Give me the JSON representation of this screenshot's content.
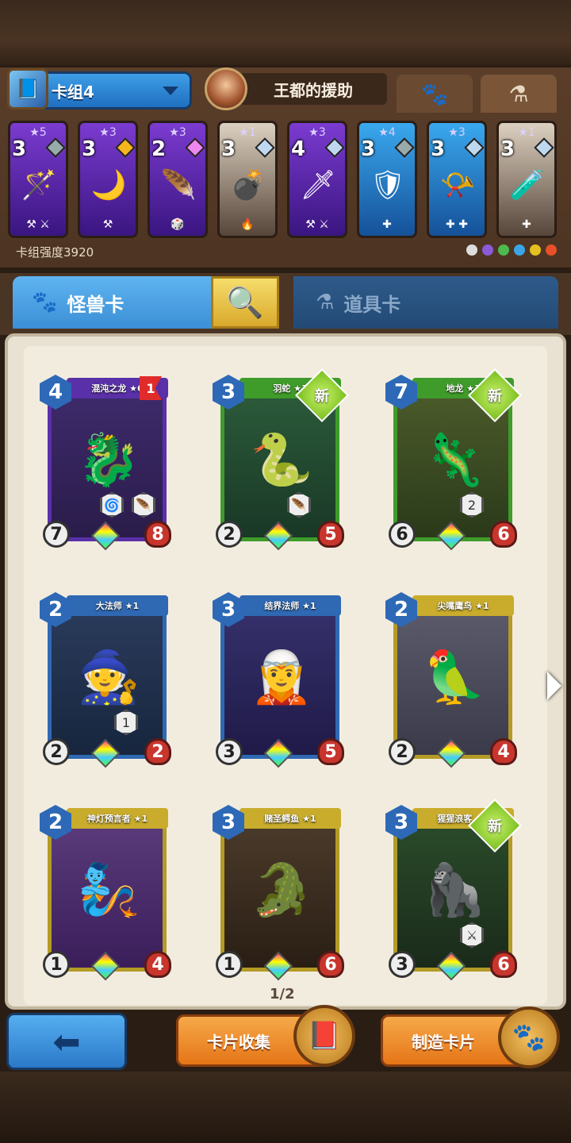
{
  "header": {
    "deck_label": "卡组4",
    "hero_name": "王都的援助",
    "deck_strength": "卡组强度3920"
  },
  "deck": [
    {
      "stars": "★5",
      "cost": "3",
      "color": "purple",
      "gem": "#9aa",
      "art": "🪄",
      "tags": "⚒ ⚔"
    },
    {
      "stars": "★3",
      "cost": "3",
      "color": "purple",
      "gem": "#f5b51f",
      "art": "🌙",
      "tags": "⚒"
    },
    {
      "stars": "★3",
      "cost": "2",
      "color": "purple",
      "gem": "#e8e",
      "art": "🪶",
      "tags": "🎲"
    },
    {
      "stars": "★1",
      "cost": "3",
      "color": "red",
      "gem": "#bfd8f0",
      "art": "💣",
      "tags": "🔥"
    },
    {
      "stars": "★3",
      "cost": "4",
      "color": "purple",
      "gem": "#bfd8f0",
      "art": "🗡",
      "tags": "⚒ ⚔"
    },
    {
      "stars": "★4",
      "cost": "3",
      "color": "blue",
      "gem": "#9aa",
      "art": "🛡",
      "tags": "✚"
    },
    {
      "stars": "★3",
      "cost": "3",
      "color": "blue",
      "gem": "#bfd8f0",
      "art": "📯",
      "tags": "✚ ✚"
    },
    {
      "stars": "★1",
      "cost": "3",
      "color": "red",
      "gem": "#bfd8f0",
      "art": "🧪",
      "tags": "✚"
    }
  ],
  "elements": [
    "#ddd",
    "#8a5ad8",
    "#4cba4c",
    "#3ba5e8",
    "#e5c020",
    "#e8502a"
  ],
  "categories": {
    "monster": "怪兽卡",
    "item": "道具卡"
  },
  "cards": [
    {
      "name": "混沌之龙 ★6",
      "cost": "4",
      "atk": "7",
      "hp": "8",
      "frame": "purplef",
      "bg": "linear-gradient(#3d2a6b,#2a1c4a)",
      "figure": "🐉",
      "flag": "1",
      "new": false,
      "abilities": [
        "🌀",
        "🪶"
      ]
    },
    {
      "name": "羽蛇 ★1",
      "cost": "3",
      "atk": "2",
      "hp": "5",
      "frame": "green",
      "bg": "linear-gradient(#2b5a3a,#193826)",
      "figure": "🐍",
      "flag": "",
      "new": true,
      "badge": "新",
      "abilities": [
        "🪶"
      ]
    },
    {
      "name": "地龙 ★1",
      "cost": "7",
      "atk": "6",
      "hp": "6",
      "frame": "green",
      "bg": "linear-gradient(#4b5a2a,#2a3a1a)",
      "figure": "🦎",
      "flag": "",
      "new": true,
      "badge": "新",
      "abilities": [
        "2"
      ]
    },
    {
      "name": "大法师 ★1",
      "cost": "2",
      "atk": "2",
      "hp": "2",
      "frame": "bluef",
      "bg": "linear-gradient(#2a3a5a,#17263e)",
      "figure": "🧙",
      "flag": "",
      "new": false,
      "abilities": [
        "1"
      ]
    },
    {
      "name": "结界法师 ★1",
      "cost": "3",
      "atk": "3",
      "hp": "5",
      "frame": "bluef",
      "bg": "linear-gradient(#35306a,#1f1a48)",
      "figure": "🧝",
      "flag": "",
      "new": false,
      "abilities": []
    },
    {
      "name": "尖嘴鹰鸟 ★1",
      "cost": "2",
      "atk": "2",
      "hp": "4",
      "frame": "yellow",
      "bg": "linear-gradient(#5a5a6a,#3a3a4a)",
      "figure": "🦜",
      "flag": "",
      "new": false,
      "abilities": []
    },
    {
      "name": "神灯预言者 ★1",
      "cost": "2",
      "atk": "1",
      "hp": "4",
      "frame": "yellow",
      "bg": "linear-gradient(#5a3a7a,#3a1e5a)",
      "figure": "🧞",
      "flag": "",
      "new": false,
      "abilities": []
    },
    {
      "name": "赌圣鳄鱼 ★1",
      "cost": "3",
      "atk": "1",
      "hp": "6",
      "frame": "yellow",
      "bg": "linear-gradient(#4a3a2a,#2a1e14)",
      "figure": "🐊",
      "flag": "",
      "new": false,
      "abilities": []
    },
    {
      "name": "猩猩浪客 ★1",
      "cost": "3",
      "atk": "3",
      "hp": "6",
      "frame": "yellow",
      "bg": "linear-gradient(#2a4a2a,#1a2a1a)",
      "figure": "🦍",
      "flag": "",
      "new": true,
      "badge": "新",
      "abilities": [
        "⚔"
      ]
    }
  ],
  "pagination": "1/2",
  "buttons": {
    "collection": "卡片收集",
    "craft": "制造卡片"
  },
  "icons": {
    "deck": "card-deck-icon",
    "paw": "paw-icon",
    "flask": "flask-icon",
    "search": "magnifier-icon",
    "back": "back-arrow-icon"
  }
}
